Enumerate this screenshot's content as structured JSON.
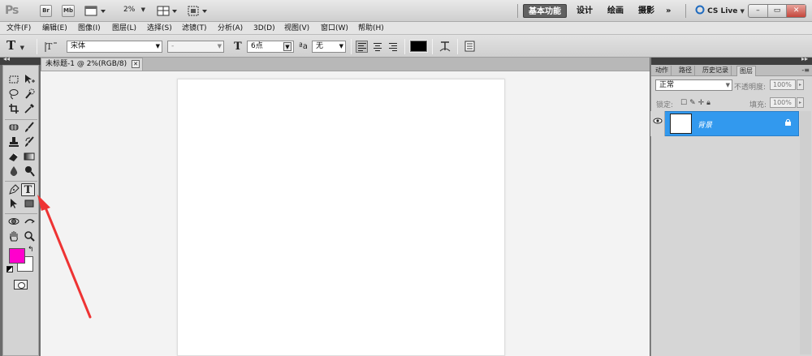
{
  "titlebar": {
    "app_logo": "Ps",
    "buttons": [
      {
        "label": "Br",
        "icon": "bridge-icon"
      },
      {
        "label": "Mb",
        "icon": "minibridge-icon"
      }
    ],
    "zoom": "2%",
    "workspaces": [
      {
        "label": "基本功能",
        "active": true
      },
      {
        "label": "设计",
        "active": false
      },
      {
        "label": "绘画",
        "active": false
      },
      {
        "label": "摄影",
        "active": false
      }
    ],
    "more_label": "»",
    "cslive_label": "CS Live",
    "window_controls": [
      "–",
      "▭",
      "✕"
    ]
  },
  "menubar": {
    "items": [
      "文件(F)",
      "编辑(E)",
      "图像(I)",
      "图层(L)",
      "选择(S)",
      "滤镜(T)",
      "分析(A)",
      "3D(D)",
      "视图(V)",
      "窗口(W)",
      "帮助(H)"
    ]
  },
  "options": {
    "tool_glyph": "T",
    "font_family": "宋体",
    "font_style": "-",
    "size_glyph": "T",
    "font_size": "6点",
    "aa_label": "ªa",
    "antialias": "无",
    "text_color": "#000000"
  },
  "document": {
    "tab_title": "未标题-1 @ 2%(RGB/8)",
    "close_glyph": "✕"
  },
  "toolbox": {
    "foreground_color": "#ff00cc",
    "background_color": "#ffffff",
    "active_tool": "type-tool"
  },
  "layers_panel": {
    "tabs": [
      "动作",
      "路径",
      "历史记录",
      "图层"
    ],
    "active_tab": "图层",
    "blend_mode": "正常",
    "opacity_label": "不透明度:",
    "opacity_value": "100%",
    "lock_label": "锁定:",
    "fill_label": "填充:",
    "fill_value": "100%",
    "layers": [
      {
        "name": "背景",
        "selected": true,
        "locked": true
      }
    ]
  },
  "colors": {
    "selection_blue": "#3299ee",
    "annotation_red": "#ee3333"
  }
}
